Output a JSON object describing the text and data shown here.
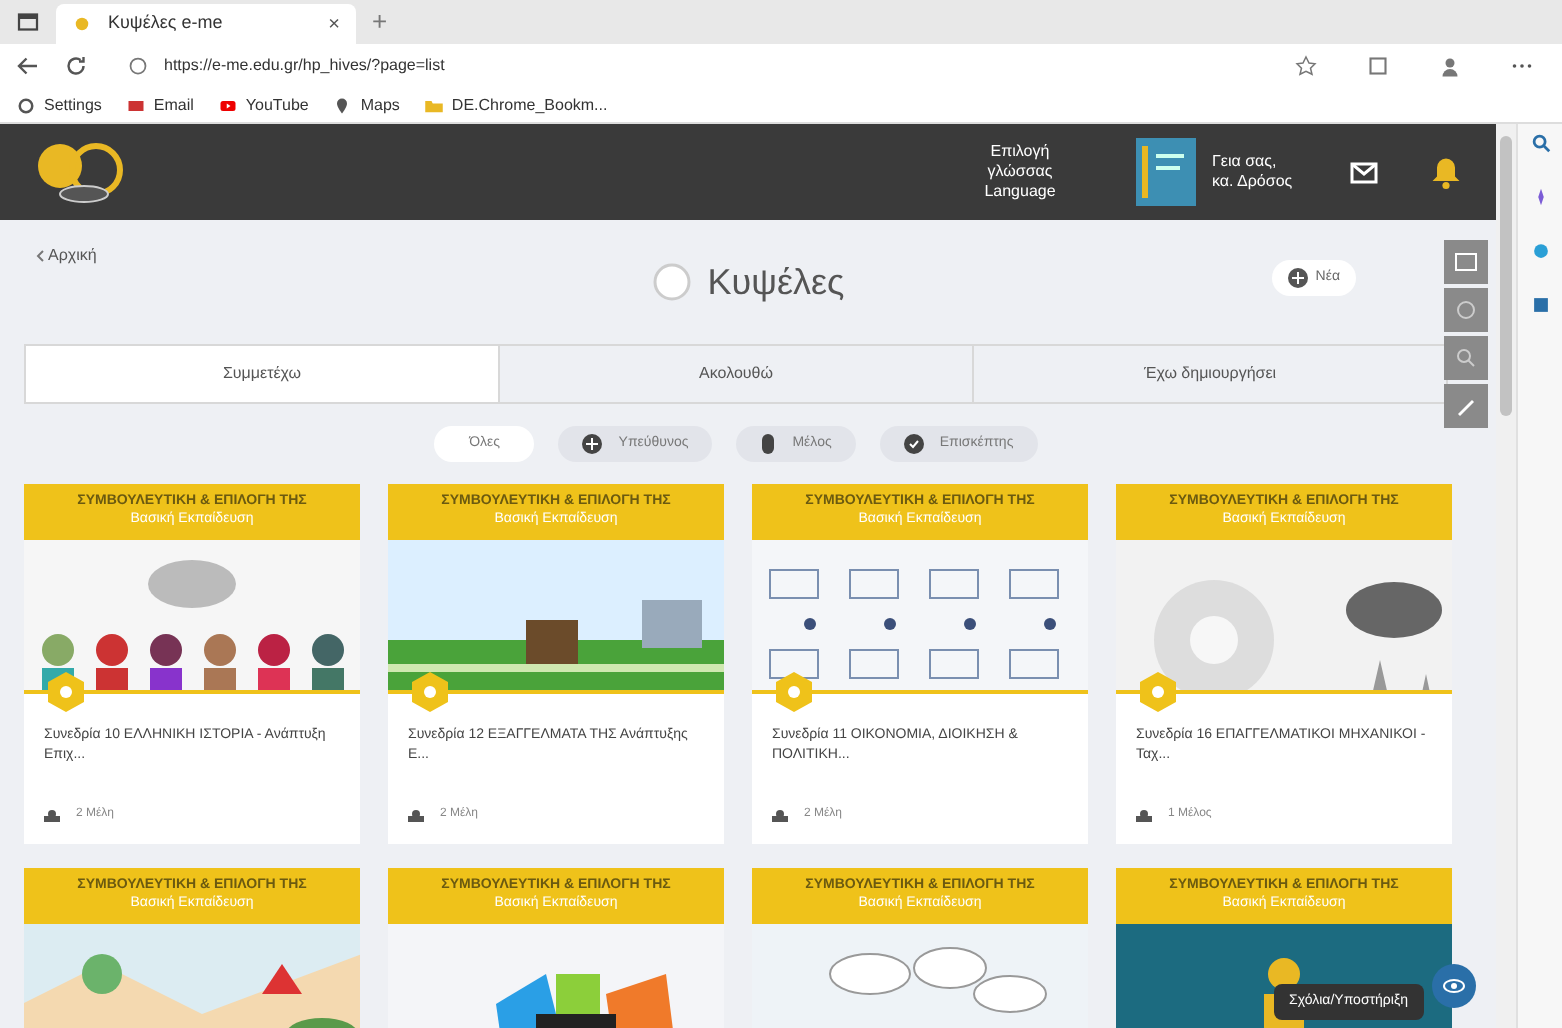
{
  "browser": {
    "tab_title": "Κυψέλες e-me",
    "tab_close": "×",
    "new_tab": "+",
    "url": "https://e-me.edu.gr/hp_hives/?page=list",
    "bookmarks": [
      {
        "label": "Settings"
      },
      {
        "label": "Email"
      },
      {
        "label": "YouTube"
      },
      {
        "label": "Maps"
      },
      {
        "label": "DE.Chrome_Bookm..."
      }
    ]
  },
  "header": {
    "language_button": "Επιλογή γλώσσας Language",
    "user_greeting": "Γεια σας, κα. Δρόσος"
  },
  "page": {
    "back_link": "Αρχική",
    "title": "Κυψέλες",
    "new_button": "Νέα"
  },
  "tabs": [
    {
      "label": "Συμμετέχω",
      "selected": true
    },
    {
      "label": "Ακολουθώ",
      "selected": false
    },
    {
      "label": "Έχω δημιουργήσει",
      "selected": false
    }
  ],
  "filters": [
    {
      "label": "Όλες",
      "kind": "plain",
      "selected": true
    },
    {
      "label": "Υπεύθυνος",
      "kind": "owner",
      "selected": false
    },
    {
      "label": "Μέλος",
      "kind": "member",
      "selected": false
    },
    {
      "label": "Επισκέπτης",
      "kind": "guest",
      "selected": false
    }
  ],
  "cards": [
    {
      "header": "ΣΥΜΒΟΥΛΕΥΤΙΚΗ & ΕΠΙΛΟΓΗ ΤΗΣ",
      "subheader": "Βασική Εκπαίδευση",
      "title": "Συνεδρία 10 ΕΛΛΗΝΙΚΗ ΙΣΤΟΡΙΑ - Ανάπτυξη Επιχ...",
      "members": "2 Μέλη"
    },
    {
      "header": "ΣΥΜΒΟΥΛΕΥΤΙΚΗ & ΕΠΙΛΟΓΗ ΤΗΣ",
      "subheader": "Βασική Εκπαίδευση",
      "title": "Συνεδρία 12 ΕΞΑΓΓΕΛΜΑΤΑ ΤΗΣ Ανάπτυξης Ε...",
      "members": "2 Μέλη"
    },
    {
      "header": "ΣΥΜΒΟΥΛΕΥΤΙΚΗ & ΕΠΙΛΟΓΗ ΤΗΣ",
      "subheader": "Βασική Εκπαίδευση",
      "title": "Συνεδρία 11 ΟΙΚΟΝΟΜΙΑ, ΔΙΟΙΚΗΣΗ & ΠΟΛΙΤΙΚΗ...",
      "members": "2 Μέλη"
    },
    {
      "header": "ΣΥΜΒΟΥΛΕΥΤΙΚΗ & ΕΠΙΛΟΓΗ ΤΗΣ",
      "subheader": "Βασική Εκπαίδευση",
      "title": "Συνεδρία 16 ΕΠΑΓΓΕΛΜΑΤΙΚΟΙ ΜΗΧΑΝΙΚΟΙ - Ταχ...",
      "members": "1 Μέλος"
    },
    {
      "header": "ΣΥΜΒΟΥΛΕΥΤΙΚΗ & ΕΠΙΛΟΓΗ ΤΗΣ",
      "subheader": "Βασική Εκπαίδευση"
    },
    {
      "header": "ΣΥΜΒΟΥΛΕΥΤΙΚΗ & ΕΠΙΛΟΓΗ ΤΗΣ",
      "subheader": "Βασική Εκπαίδευση"
    },
    {
      "header": "ΣΥΜΒΟΥΛΕΥΤΙΚΗ & ΕΠΙΛΟΓΗ ΤΗΣ",
      "subheader": "Βασική Εκπαίδευση"
    },
    {
      "header": "ΣΥΜΒΟΥΛΕΥΤΙΚΗ & ΕΠΙΛΟΓΗ ΤΗΣ",
      "subheader": "Βασική Εκπαίδευση"
    }
  ],
  "tooltip": "Σχόλια/Υποστήριξη"
}
